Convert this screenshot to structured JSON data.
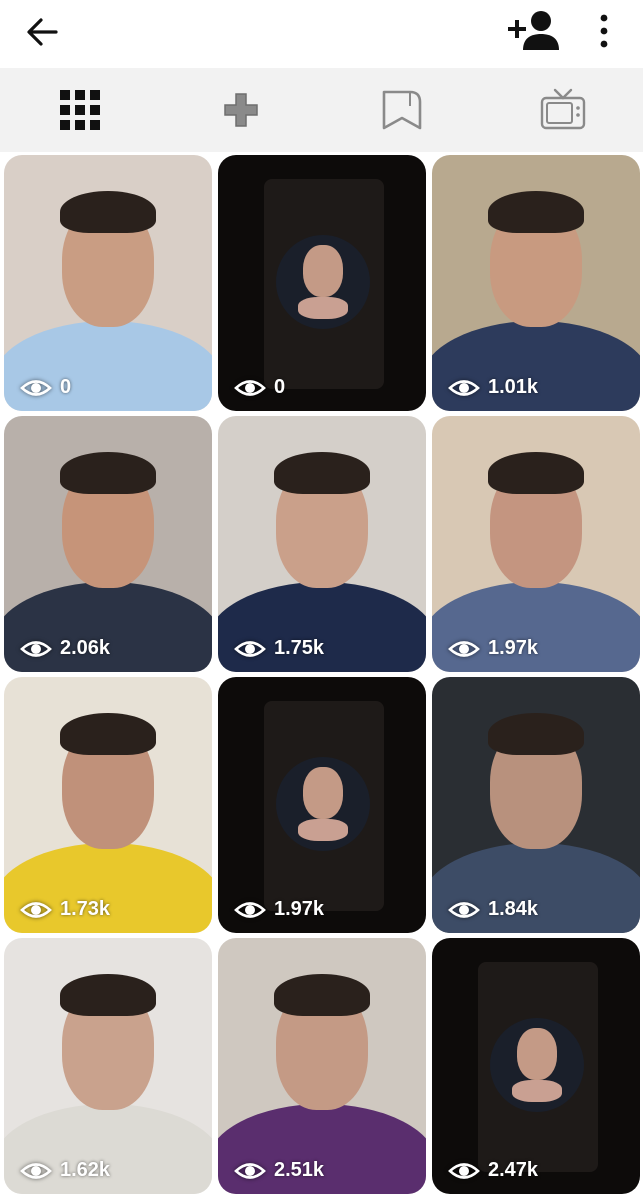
{
  "header": {
    "back_icon": "arrow-left-icon",
    "add_user_icon": "person-plus-icon",
    "more_icon": "vertical-dots-icon"
  },
  "tabs": [
    {
      "name": "grid",
      "icon": "grid-icon",
      "active": true
    },
    {
      "name": "igtv-add",
      "icon": "plus-icon",
      "active": false
    },
    {
      "name": "saved",
      "icon": "bookmark-icon",
      "active": false
    },
    {
      "name": "tv",
      "icon": "tv-icon",
      "active": false
    }
  ],
  "videos": [
    {
      "views": "0",
      "bg": "#d9cfc7",
      "skin": "#c99d83",
      "shirt": "#a8c8e6",
      "style": "person"
    },
    {
      "views": "0",
      "bg": "#0d0b0a",
      "skin": "#000000",
      "shirt": "#000000",
      "style": "circle"
    },
    {
      "views": "1.01k",
      "bg": "#b8a98f",
      "skin": "#c89a80",
      "shirt": "#2d3b5c",
      "style": "person"
    },
    {
      "views": "2.06k",
      "bg": "#b8b0aa",
      "skin": "#c69479",
      "shirt": "#2b3345",
      "style": "person"
    },
    {
      "views": "1.75k",
      "bg": "#d4cfc9",
      "skin": "#caa08a",
      "shirt": "#1e2a4a",
      "style": "person"
    },
    {
      "views": "1.97k",
      "bg": "#d8c8b4",
      "skin": "#c49580",
      "shirt": "#56688f",
      "style": "person"
    },
    {
      "views": "1.73k",
      "bg": "#e7e1d6",
      "skin": "#c0917a",
      "shirt": "#e8c82c",
      "style": "person"
    },
    {
      "views": "1.97k",
      "bg": "#0d0b0a",
      "skin": "#000000",
      "shirt": "#000000",
      "style": "circle"
    },
    {
      "views": "1.84k",
      "bg": "#2a2e33",
      "skin": "#b8917d",
      "shirt": "#3d4c66",
      "style": "person"
    },
    {
      "views": "1.62k",
      "bg": "#e6e3e0",
      "skin": "#c9a28d",
      "shirt": "#dcdad4",
      "style": "person"
    },
    {
      "views": "2.51k",
      "bg": "#cfc8c0",
      "skin": "#c49a85",
      "shirt": "#5a2e6e",
      "style": "person"
    },
    {
      "views": "2.47k",
      "bg": "#0d0b0a",
      "skin": "#000000",
      "shirt": "#000000",
      "style": "circle"
    }
  ],
  "colors": {
    "icon_dark": "#111111",
    "icon_gray": "#8a8a8a",
    "tab_bg": "#f2f2f2"
  }
}
